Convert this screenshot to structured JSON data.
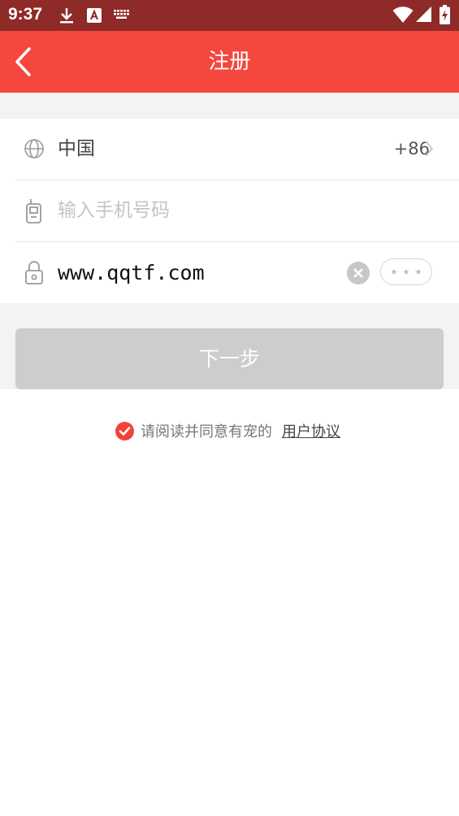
{
  "status_bar": {
    "time": "9:37"
  },
  "header": {
    "title": "注册"
  },
  "form": {
    "country": {
      "label": "中国",
      "code": "+86"
    },
    "phone": {
      "placeholder": "输入手机号码"
    },
    "password": {
      "value": "www.qqtf.com"
    }
  },
  "next_button": {
    "label": "下一步"
  },
  "agreement": {
    "text": "请阅读并同意有宠的",
    "link": "用户协议"
  },
  "colors": {
    "status_bar": "#8e2a27",
    "header": "#f5473e",
    "check": "#f2423a",
    "button_disabled": "#cdcdcd"
  }
}
